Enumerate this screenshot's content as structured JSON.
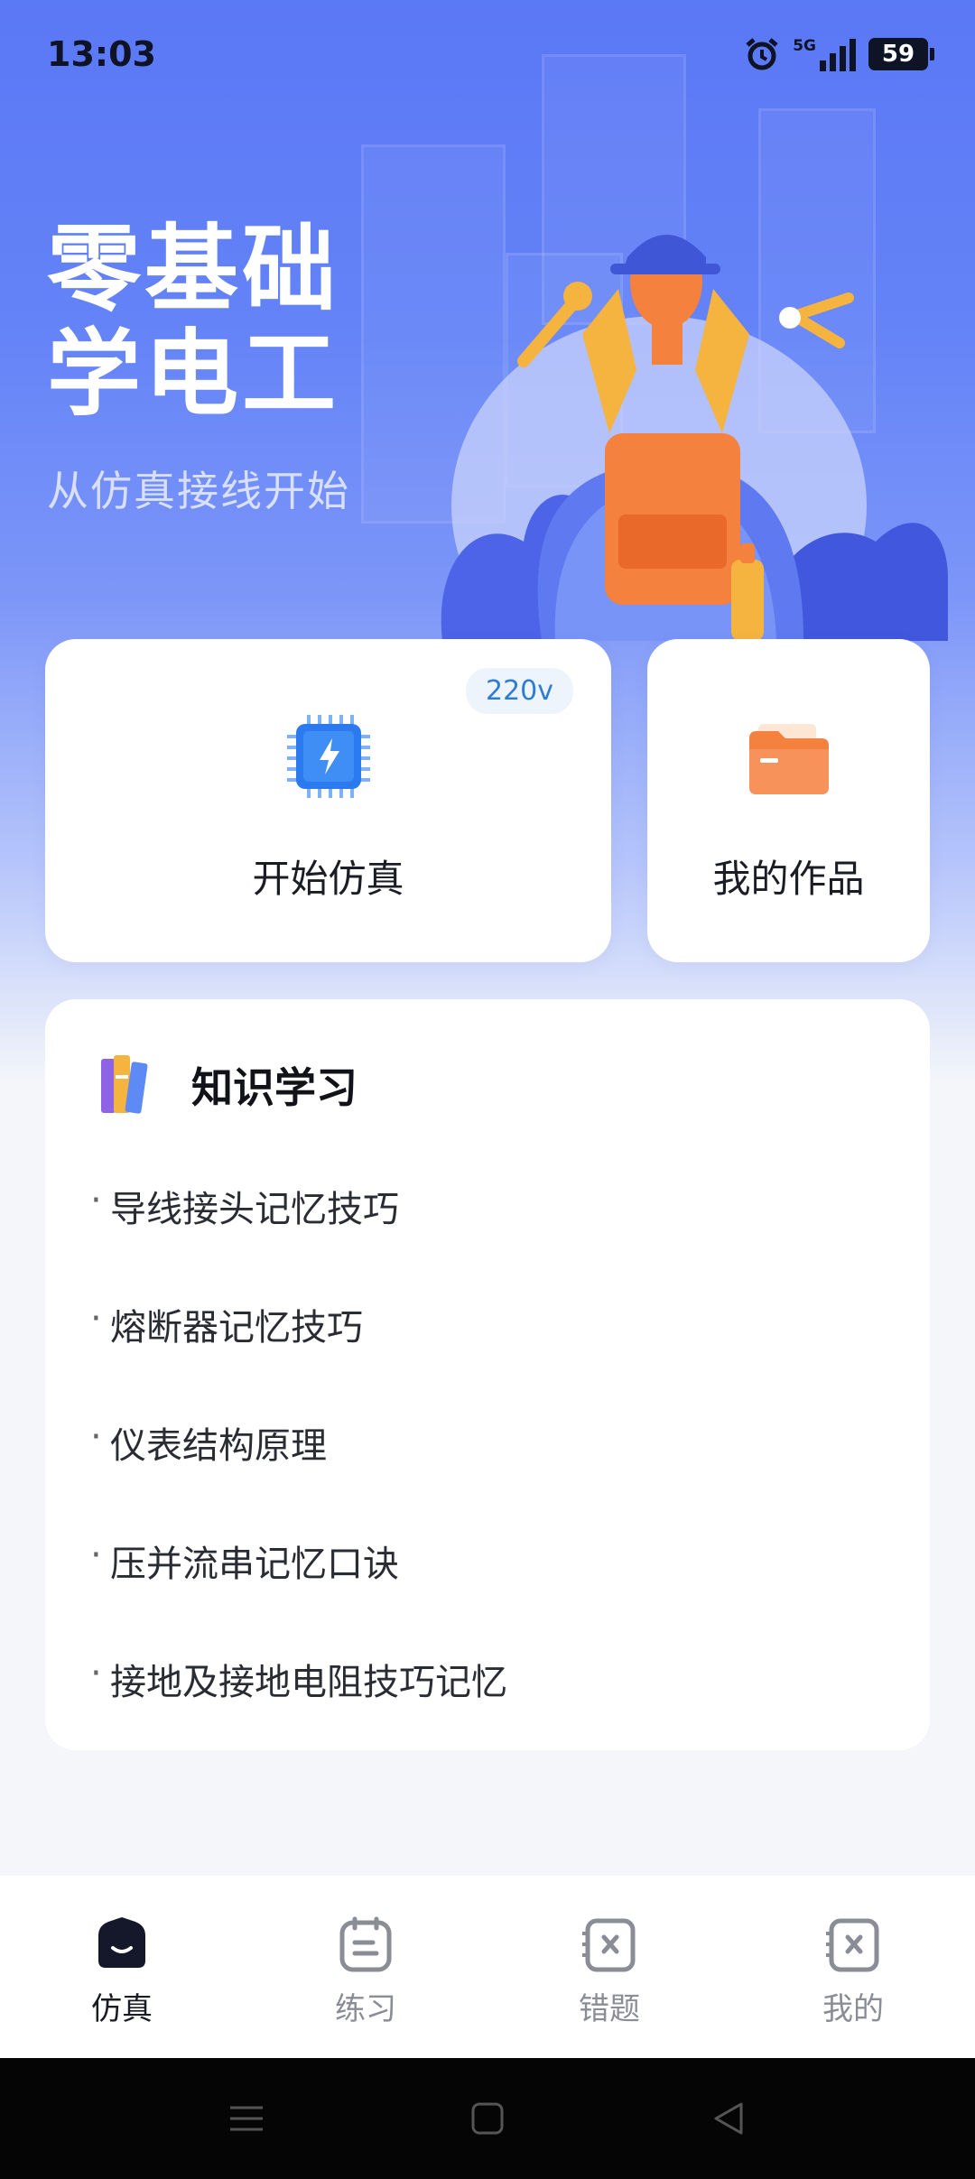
{
  "status_bar": {
    "time": "13:03",
    "network": "5G",
    "battery": "59"
  },
  "hero": {
    "title_line1": "零基础",
    "title_line2": "学电工",
    "subtitle": "从仿真接线开始"
  },
  "cards": {
    "simulation": {
      "label": "开始仿真",
      "badge": "220v",
      "icon": "chip-lightning-icon"
    },
    "works": {
      "label": "我的作品",
      "icon": "folder-icon"
    }
  },
  "knowledge": {
    "title": "知识学习",
    "icon": "books-icon",
    "items": [
      "导线接头记忆技巧",
      "熔断器记忆技巧",
      "仪表结构原理",
      "压并流串记忆口诀",
      "接地及接地电阻技巧记忆"
    ]
  },
  "tabs": [
    {
      "label": "仿真",
      "icon": "simulation-tab-icon",
      "active": true
    },
    {
      "label": "练习",
      "icon": "practice-tab-icon",
      "active": false
    },
    {
      "label": "错题",
      "icon": "wrong-questions-tab-icon",
      "active": false
    },
    {
      "label": "我的",
      "icon": "profile-tab-icon",
      "active": false
    }
  ],
  "colors": {
    "hero": "#5b78f5",
    "accent_blue": "#2f7cd3",
    "orange": "#f5813f",
    "background": "#f4f6fa"
  }
}
